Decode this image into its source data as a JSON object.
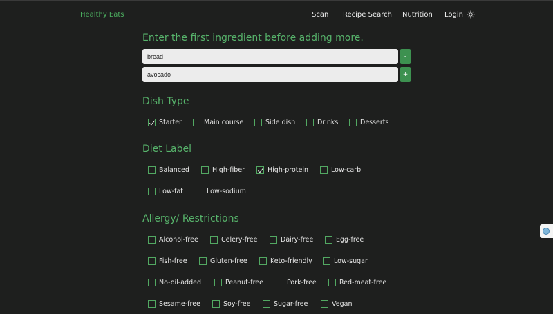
{
  "nav": {
    "brand": "Healthy Eats",
    "items": [
      "Scan",
      "Recipe Search",
      "Nutrition",
      "Login"
    ],
    "theme_icon": "sun-icon"
  },
  "ingredients": {
    "prompt": "Enter the first ingredient before adding more.",
    "fields": [
      {
        "value": "bread",
        "button": "-"
      },
      {
        "value": "avocado",
        "button": "+"
      }
    ]
  },
  "dish_type": {
    "title": "Dish Type",
    "options": [
      {
        "label": "Starter",
        "checked": true
      },
      {
        "label": "Main course",
        "checked": false
      },
      {
        "label": "Side dish",
        "checked": false
      },
      {
        "label": "Drinks",
        "checked": false
      },
      {
        "label": "Desserts",
        "checked": false
      }
    ]
  },
  "diet_label": {
    "title": "Diet Label",
    "options": [
      {
        "label": "Balanced",
        "checked": false
      },
      {
        "label": "High-fiber",
        "checked": false
      },
      {
        "label": "High-protein",
        "checked": true
      },
      {
        "label": "Low-carb",
        "checked": false
      },
      {
        "label": "Low-fat",
        "checked": false
      },
      {
        "label": "Low-sodium",
        "checked": false
      }
    ]
  },
  "allergy": {
    "title": "Allergy/ Restrictions",
    "options": [
      {
        "label": "Alcohol-free",
        "checked": false
      },
      {
        "label": "Celery-free",
        "checked": false
      },
      {
        "label": "Dairy-free",
        "checked": false
      },
      {
        "label": "Egg-free",
        "checked": false
      },
      {
        "label": "Fish-free",
        "checked": false
      },
      {
        "label": "Gluten-free",
        "checked": false
      },
      {
        "label": "Keto-friendly",
        "checked": false
      },
      {
        "label": "Low-sugar",
        "checked": false
      },
      {
        "label": "No-oil-added",
        "checked": false
      },
      {
        "label": "Peanut-free",
        "checked": false
      },
      {
        "label": "Pork-free",
        "checked": false
      },
      {
        "label": "Red-meat-free",
        "checked": false
      },
      {
        "label": "Sesame-free",
        "checked": false
      },
      {
        "label": "Soy-free",
        "checked": false
      },
      {
        "label": "Sugar-free",
        "checked": false
      },
      {
        "label": "Vegan",
        "checked": false
      }
    ]
  },
  "colors": {
    "background": "#1e1f1e",
    "accent": "#57b36b",
    "button": "#3d9150"
  }
}
